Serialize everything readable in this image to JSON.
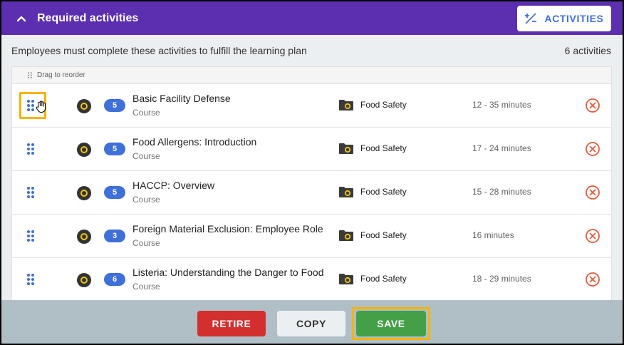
{
  "header": {
    "title": "Required activities",
    "activities_button_label": "ACTIVITIES"
  },
  "subheader": {
    "description": "Employees must complete these activities to fulfill the learning plan",
    "count_label": "6 activities"
  },
  "list": {
    "drag_hint": "Drag to reorder",
    "rows": [
      {
        "badge": "5",
        "title": "Basic Facility Defense",
        "type": "Course",
        "category": "Food Safety",
        "duration": "12 - 35 minutes"
      },
      {
        "badge": "5",
        "title": "Food Allergens: Introduction",
        "type": "Course",
        "category": "Food Safety",
        "duration": "17 - 24 minutes"
      },
      {
        "badge": "5",
        "title": "HACCP: Overview",
        "type": "Course",
        "category": "Food Safety",
        "duration": "15 - 28 minutes"
      },
      {
        "badge": "3",
        "title": "Foreign Material Exclusion: Employee Role",
        "type": "Course",
        "category": "Food Safety",
        "duration": "16 minutes"
      },
      {
        "badge": "6",
        "title": "Listeria: Understanding the Danger to Food",
        "type": "Course",
        "category": "Food Safety",
        "duration": "18 - 29 minutes"
      }
    ]
  },
  "footer": {
    "retire_label": "RETIRE",
    "copy_label": "COPY",
    "save_label": "SAVE"
  },
  "colors": {
    "header_bg": "#5c2fb0",
    "accent_blue": "#3f6fd8",
    "retire_red": "#d32f2f",
    "save_green": "#43a047",
    "highlight_yellow": "#f4b400",
    "remove_orange": "#e65c3c"
  },
  "icons": {
    "collapse": "chevron-up-icon",
    "activities": "add-remove-icon",
    "drag_hint": "drag-dots-icon",
    "drag": "drag-handle-icon",
    "vendor": "vendor-logo-icon",
    "folder": "folder-icon",
    "remove": "remove-circle-icon",
    "cursor": "hand-cursor-icon"
  }
}
